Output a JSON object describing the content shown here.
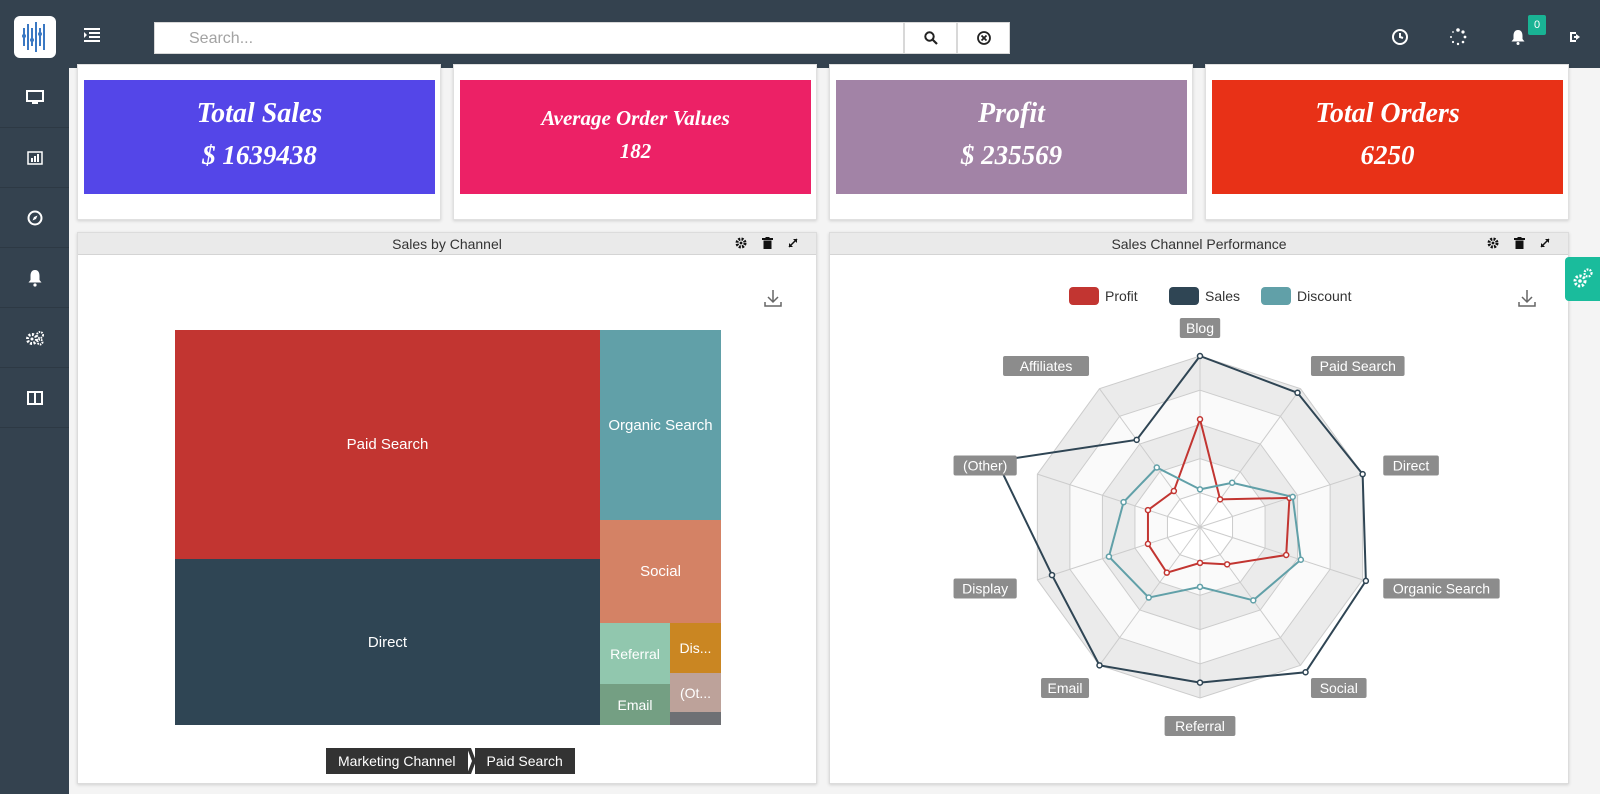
{
  "search": {
    "placeholder": "Search..."
  },
  "notifications": {
    "count": "0"
  },
  "kpis": [
    {
      "title": "Total Sales",
      "value": "$ 1639438",
      "color": "#5446e8"
    },
    {
      "title": "Average Order Values",
      "value": "182",
      "color": "#ec2166"
    },
    {
      "title": "Profit",
      "value": "$ 235569",
      "color": "#a283a6"
    },
    {
      "title": "Total Orders",
      "value": "6250",
      "color": "#e83117"
    }
  ],
  "panels": {
    "left": {
      "title": "Sales by Channel"
    },
    "right": {
      "title": "Sales Channel Performance"
    }
  },
  "treemap": {
    "cells": [
      {
        "label": "Paid Search",
        "color": "#c23531"
      },
      {
        "label": "Direct",
        "color": "#2f4554"
      },
      {
        "label": "Organic Search",
        "color": "#61a0a8"
      },
      {
        "label": "Social",
        "color": "#d48265"
      },
      {
        "label": "Referral",
        "color": "#91c7ae"
      },
      {
        "label": "Dis...",
        "color": "#ca8622"
      },
      {
        "label": "Email",
        "color": "#749f83"
      },
      {
        "label": "(Ot...",
        "color": "#bda29a"
      },
      {
        "label": "",
        "color": "#6e7074"
      }
    ],
    "breadcrumb": [
      "Marketing Channel",
      "Paid Search"
    ]
  },
  "chart_data": {
    "type": "radar",
    "legend": [
      "Profit",
      "Sales",
      "Discount"
    ],
    "colors": {
      "Profit": "#c23531",
      "Sales": "#2f4554",
      "Discount": "#61a0a8"
    },
    "indicators": [
      "Blog",
      "Paid Search",
      "Direct",
      "Organic Search",
      "Social",
      "Referral",
      "Email",
      "Display",
      "(Other)",
      "Affiliates"
    ],
    "series": [
      {
        "name": "Profit",
        "values": [
          0.63,
          0.2,
          0.55,
          0.53,
          0.27,
          0.21,
          0.33,
          0.32,
          0.32,
          0.26
        ]
      },
      {
        "name": "Sales",
        "values": [
          1.0,
          0.97,
          1.0,
          1.02,
          1.05,
          0.91,
          1.0,
          0.91,
          1.25,
          0.63
        ]
      },
      {
        "name": "Discount",
        "values": [
          0.22,
          0.32,
          0.57,
          0.62,
          0.53,
          0.35,
          0.51,
          0.56,
          0.47,
          0.43
        ]
      }
    ],
    "max": 1.0
  }
}
